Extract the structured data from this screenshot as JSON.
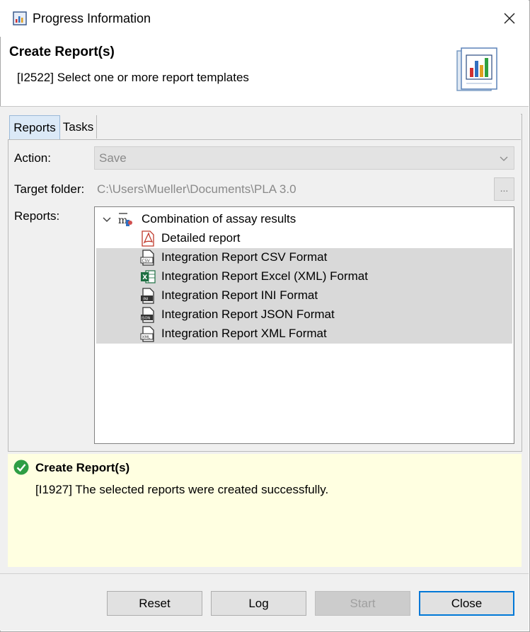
{
  "window": {
    "title": "Progress Information",
    "close_icon": "close-icon"
  },
  "header": {
    "title": "Create Report(s)",
    "message": "[I2522] Select one or more report templates",
    "art_icon": "report-chart-icon"
  },
  "tabs": [
    {
      "label": "Reports",
      "active": true
    },
    {
      "label": "Tasks",
      "active": false
    }
  ],
  "form": {
    "action_label": "Action:",
    "action_value": "Save",
    "target_label": "Target folder:",
    "target_value": "C:\\Users\\Mueller\\Documents\\PLA 3.0",
    "browse_label": "...",
    "reports_label": "Reports:"
  },
  "tree": {
    "root": {
      "label": "Combination of assay results",
      "icon": "assay-combination-icon",
      "expanded": true
    },
    "items": [
      {
        "label": "Detailed report",
        "icon": "pdf-icon",
        "selected": false
      },
      {
        "label": "Integration Report CSV Format",
        "icon": "csv-file-icon",
        "selected": true
      },
      {
        "label": "Integration Report Excel (XML) Format",
        "icon": "excel-file-icon",
        "selected": true
      },
      {
        "label": "Integration Report INI Format",
        "icon": "ini-file-icon",
        "selected": true
      },
      {
        "label": "Integration Report JSON Format",
        "icon": "json-file-icon",
        "selected": true
      },
      {
        "label": "Integration Report XML Format",
        "icon": "xml-file-icon",
        "selected": true
      }
    ]
  },
  "status": {
    "icon": "success-check-icon",
    "title": "Create Report(s)",
    "message": "[I1927] The selected reports were created successfully."
  },
  "buttons": {
    "reset": "Reset",
    "log": "Log",
    "start": "Start",
    "close": "Close"
  },
  "colors": {
    "accent": "#0078d7",
    "status_bg": "#ffffe1",
    "selection": "#d9d9d9",
    "success": "#2e9e44"
  }
}
